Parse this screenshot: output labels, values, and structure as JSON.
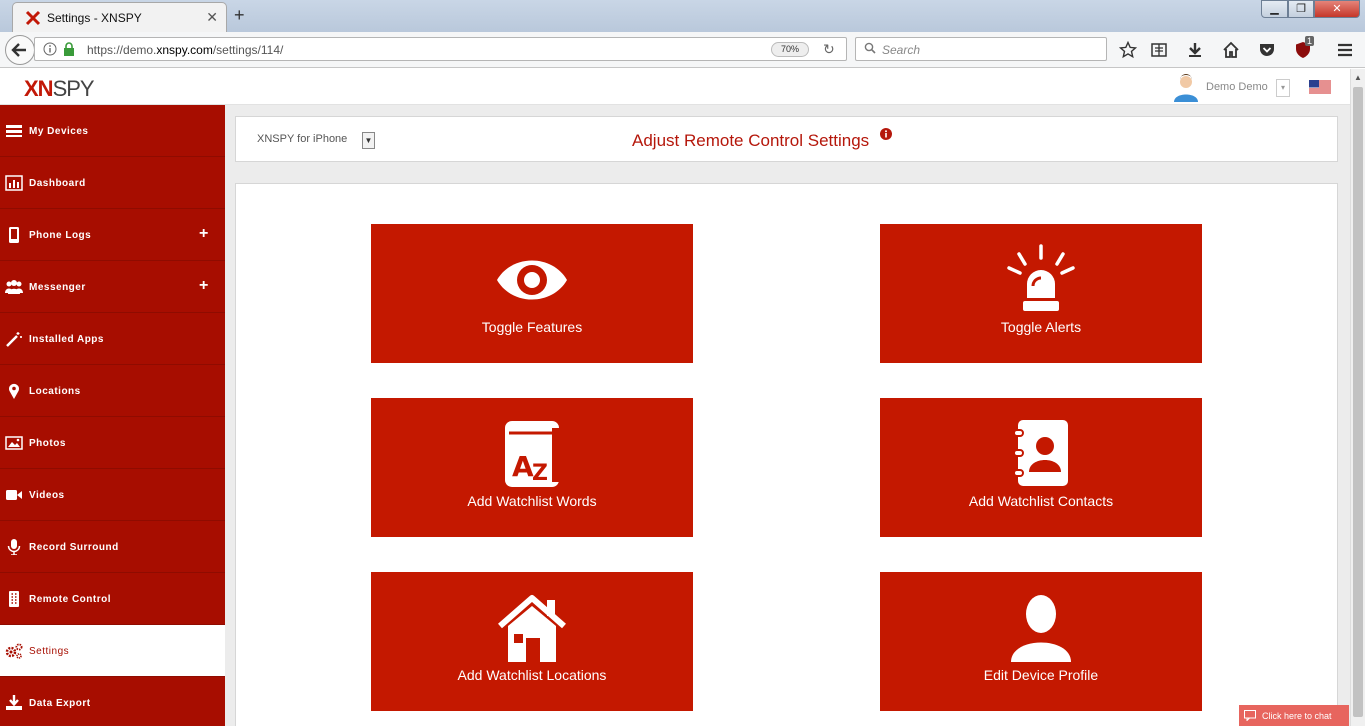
{
  "browser": {
    "tab_title": "Settings - XNSPY",
    "url_prefix": "https://demo.",
    "url_domain": "xnspy.com",
    "url_path": "/settings/114/",
    "zoom": "70%",
    "search_placeholder": "Search",
    "ublock_count": "1"
  },
  "header": {
    "logo_xn": "XN",
    "logo_spy": "SPY",
    "user_name": "Demo Demo"
  },
  "sidebar": {
    "items": [
      {
        "label": "My Devices",
        "icon": "devices-icon"
      },
      {
        "label": "Dashboard",
        "icon": "dashboard-icon"
      },
      {
        "label": "Phone Logs",
        "icon": "phone-icon",
        "expand": "+"
      },
      {
        "label": "Messenger",
        "icon": "users-icon",
        "expand": "+"
      },
      {
        "label": "Installed Apps",
        "icon": "magic-wand-icon"
      },
      {
        "label": "Locations",
        "icon": "map-pin-icon"
      },
      {
        "label": "Photos",
        "icon": "image-icon"
      },
      {
        "label": "Videos",
        "icon": "video-camera-icon"
      },
      {
        "label": "Record Surround",
        "icon": "microphone-icon"
      },
      {
        "label": "Remote Control",
        "icon": "remote-icon"
      },
      {
        "label": "Settings",
        "icon": "gears-icon",
        "active": true
      },
      {
        "label": "Data Export",
        "icon": "download-icon"
      }
    ]
  },
  "main": {
    "device_select": "XNSPY for iPhone",
    "title": "Adjust Remote Control Settings",
    "tiles": [
      {
        "label": "Toggle Features",
        "icon": "eye-icon"
      },
      {
        "label": "Toggle Alerts",
        "icon": "siren-icon"
      },
      {
        "label": "Add Watchlist Words",
        "icon": "dictionary-az-icon"
      },
      {
        "label": "Add Watchlist Contacts",
        "icon": "address-book-icon"
      },
      {
        "label": "Add Watchlist Locations",
        "icon": "house-icon"
      },
      {
        "label": "Edit Device Profile",
        "icon": "person-icon"
      }
    ]
  },
  "chat": {
    "label": "Click here to chat"
  },
  "colors": {
    "brand_red": "#c41800",
    "sidebar_red": "#a70d00",
    "title_red": "#b5170b"
  }
}
